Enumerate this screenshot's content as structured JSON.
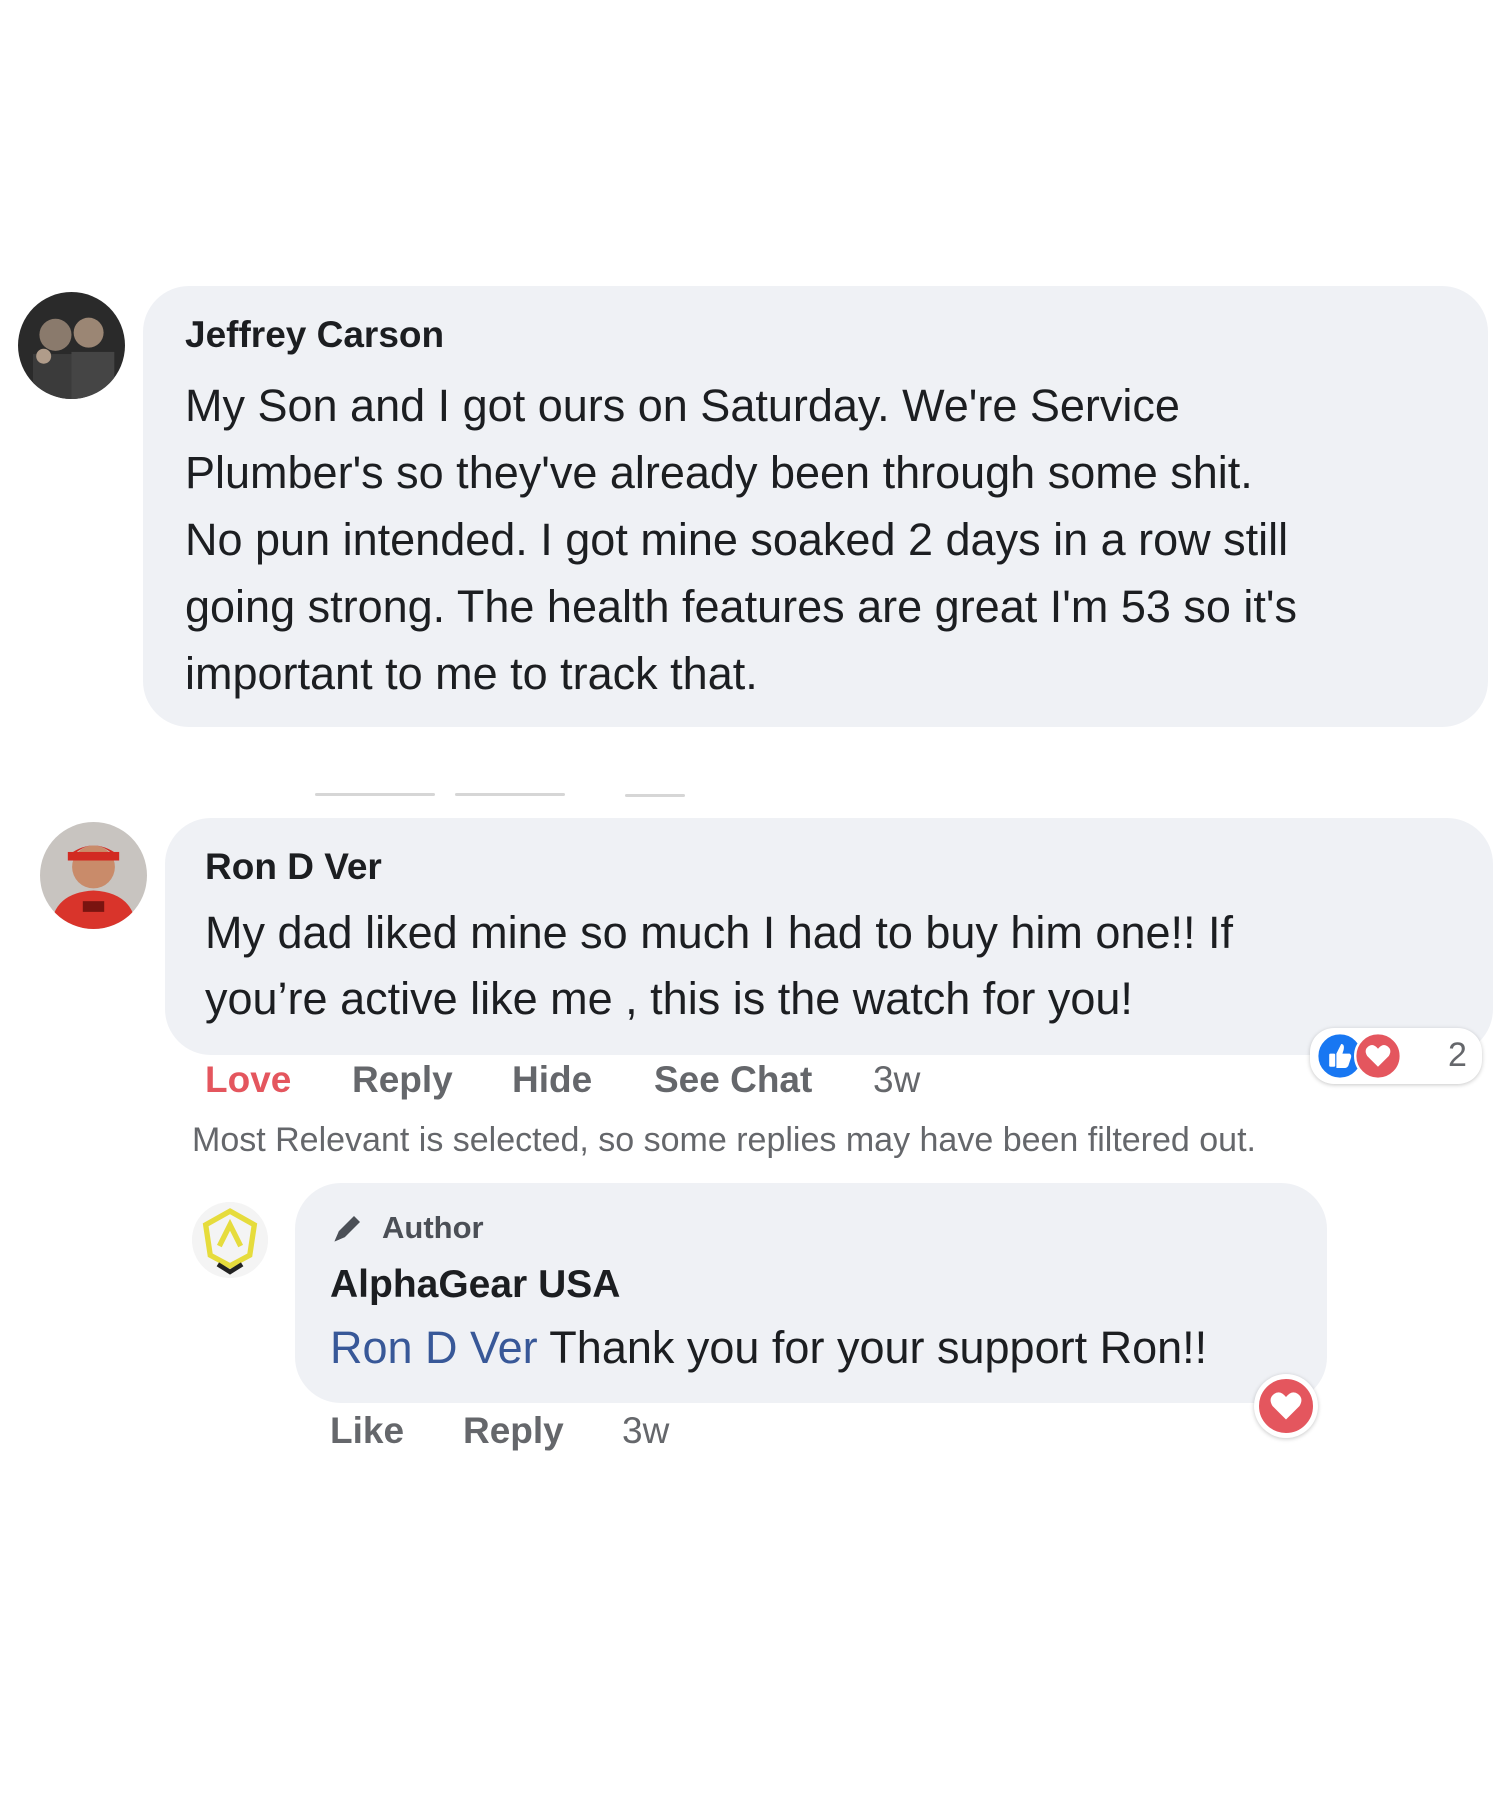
{
  "comments": [
    {
      "author": "Jeffrey Carson",
      "lines": [
        "My Son and I got ours on Saturday. We're Service",
        "Plumber's so they've already been through some shit.",
        "No pun intended. I got mine soaked 2 days in a row still",
        "going strong. The health features are great I'm 53 so it's",
        "important to me to track that."
      ]
    },
    {
      "author": "Ron D Ver",
      "lines": [
        "My dad liked mine so much I had to buy him one!! If",
        "you’re active like me , this is the watch for you!"
      ],
      "actions": {
        "love": "Love",
        "reply": "Reply",
        "hide": "Hide",
        "see_chat": "See Chat",
        "time": "3w"
      },
      "reactions": {
        "icons": [
          "like-icon",
          "love-icon"
        ],
        "count": "2"
      }
    }
  ],
  "notice": "Most Relevant is selected, so some replies may have been filtered out.",
  "reply": {
    "badge": "Author",
    "author": "AlphaGear USA",
    "mention": "Ron D Ver",
    "text": " Thank you for your support Ron!!",
    "actions": {
      "like": "Like",
      "reply": "Reply",
      "time": "3w"
    },
    "reactions": {
      "icons": [
        "love-icon"
      ]
    }
  },
  "colors": {
    "bubble": "#eff1f5",
    "love": "#e4565e",
    "like_blue": "#1877f2",
    "mention": "#385898",
    "secondary_text": "#65676b"
  }
}
